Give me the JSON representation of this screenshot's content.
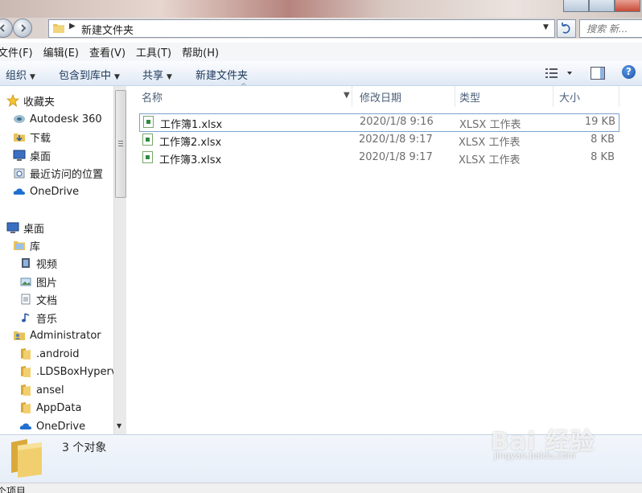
{
  "window": {
    "address": "新建文件夹",
    "search_placeholder": "搜索 新..."
  },
  "menubar": [
    "文件(F)",
    "编辑(E)",
    "查看(V)",
    "工具(T)",
    "帮助(H)"
  ],
  "toolbar": {
    "organize": "组织",
    "include_library": "包含到库中",
    "share": "共享",
    "new_folder": "新建文件夹"
  },
  "nav": {
    "favorites": [
      {
        "label": "收藏夹",
        "icon": "star-icon"
      },
      {
        "label": "Autodesk 360",
        "icon": "cloud-drive-icon"
      },
      {
        "label": "下载",
        "icon": "download-folder-icon"
      },
      {
        "label": "桌面",
        "icon": "desktop-icon"
      },
      {
        "label": "最近访问的位置",
        "icon": "recent-places-icon"
      },
      {
        "label": "OneDrive",
        "icon": "onedrive-icon"
      }
    ],
    "tree": [
      {
        "label": "桌面",
        "icon": "desktop-icon"
      },
      {
        "label": "库",
        "icon": "library-icon"
      },
      {
        "label": "视频",
        "icon": "video-library-icon"
      },
      {
        "label": "图片",
        "icon": "pictures-library-icon"
      },
      {
        "label": "文档",
        "icon": "documents-library-icon"
      },
      {
        "label": "音乐",
        "icon": "music-library-icon"
      },
      {
        "label": "Administrator",
        "icon": "user-folder-icon"
      },
      {
        "label": ".android",
        "icon": "folder-icon"
      },
      {
        "label": ".LDSBoxHyperv",
        "icon": "folder-icon"
      },
      {
        "label": "ansel",
        "icon": "folder-icon"
      },
      {
        "label": "AppData",
        "icon": "folder-icon"
      },
      {
        "label": "OneDrive",
        "icon": "onedrive-icon"
      }
    ]
  },
  "columns": {
    "name": "名称",
    "modified": "修改日期",
    "type": "类型",
    "size": "大小"
  },
  "files": [
    {
      "name": "工作簿1.xlsx",
      "modified": "2020/1/8 9:16",
      "type": "XLSX 工作表",
      "size": "19 KB",
      "icon": "excel-file-icon"
    },
    {
      "name": "工作簿2.xlsx",
      "modified": "2020/1/8 9:17",
      "type": "XLSX 工作表",
      "size": "8 KB",
      "icon": "excel-file-icon"
    },
    {
      "name": "工作簿3.xlsx",
      "modified": "2020/1/8 9:17",
      "type": "XLSX 工作表",
      "size": "8 KB",
      "icon": "excel-file-icon"
    }
  ],
  "details": {
    "count": "3 个对象"
  },
  "statusbar": {
    "text": "个项目"
  },
  "watermark": {
    "brand": "Bai  经验",
    "url": "jingyan.baidu.com"
  },
  "colors": {
    "accent": "#1e395b",
    "selection_border": "#7da2ce",
    "header_text": "#4c607a"
  }
}
